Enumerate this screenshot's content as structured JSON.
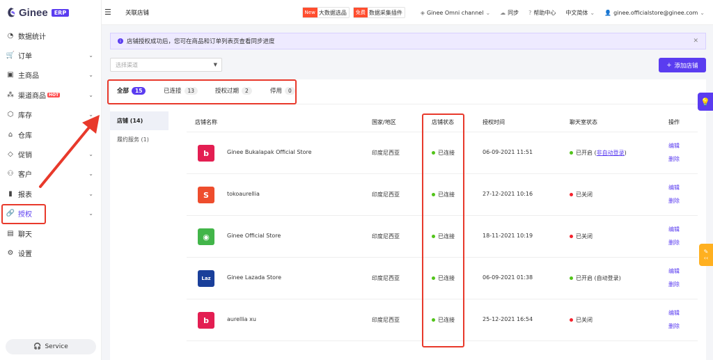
{
  "brand": {
    "name": "Ginee",
    "badge": "ERP"
  },
  "sidebar": {
    "items": [
      {
        "label": "数据统计",
        "icon": "dashboard-icon",
        "chev": false
      },
      {
        "label": "订单",
        "icon": "cart-icon",
        "chev": true
      },
      {
        "label": "主商品",
        "icon": "bag-icon",
        "chev": true
      },
      {
        "label": "渠道商品",
        "icon": "channel-icon",
        "chev": true,
        "hot": "HOT"
      },
      {
        "label": "库存",
        "icon": "box-icon",
        "chev": true
      },
      {
        "label": "仓库",
        "icon": "warehouse-icon",
        "chev": false
      },
      {
        "label": "促销",
        "icon": "tag-icon",
        "chev": true
      },
      {
        "label": "客户",
        "icon": "users-icon",
        "chev": true
      },
      {
        "label": "报表",
        "icon": "chart-icon",
        "chev": true
      },
      {
        "label": "授权",
        "icon": "link-icon",
        "chev": true,
        "active": true
      },
      {
        "label": "聊天",
        "icon": "chat-icon",
        "chev": false
      },
      {
        "label": "设置",
        "icon": "gear-icon",
        "chev": false
      }
    ],
    "service_label": "Service"
  },
  "header": {
    "title": "关联店铺",
    "big_data_tag": "New",
    "big_data_label": "大数据选品",
    "plugin_tag": "免费",
    "plugin_label": "数据采集插件",
    "omni": "Ginee Omni channel",
    "sync": "同步",
    "help": "帮助中心",
    "language": "中文简体",
    "account": "ginee.officialstore@ginee.com"
  },
  "notice": {
    "text": "店铺授权成功后，您可在商品和订单列表页查看同步进度"
  },
  "toolbar": {
    "channel_placeholder": "选择渠道",
    "add_store": "添加店铺"
  },
  "tabs": [
    {
      "label": "全部",
      "count": "15",
      "active": true
    },
    {
      "label": "已连接",
      "count": "13"
    },
    {
      "label": "授权过期",
      "count": "2"
    },
    {
      "label": "停用",
      "count": "0"
    }
  ],
  "subnav": [
    {
      "label": "店铺 (14)",
      "active": true
    },
    {
      "label": "履约服务 (1)"
    }
  ],
  "table": {
    "columns": [
      "店铺名称",
      "国家/地区",
      "店铺状态",
      "授权时间",
      "聊天室状态",
      "操作"
    ],
    "rows": [
      {
        "logo": "bukalapak",
        "name": "Ginee Bukalapak Official Store",
        "country": "印度尼西亚",
        "status": "已连接",
        "time": "06-09-2021 11:51",
        "chat": "已开启 (",
        "chat_link": "非自动登录",
        "chat_suffix": ")",
        "chat_on": true,
        "edit": "编辑",
        "delete": "删除"
      },
      {
        "logo": "shopee",
        "name": "tokoaurellia",
        "country": "印度尼西亚",
        "status": "已连接",
        "time": "27-12-2021 10:16",
        "chat": "已关闭",
        "chat_link": "",
        "chat_suffix": "",
        "chat_on": false,
        "edit": "编辑",
        "delete": "删除"
      },
      {
        "logo": "tokopedia",
        "name": "Ginee Official Store",
        "country": "印度尼西亚",
        "status": "已连接",
        "time": "18-11-2021 10:19",
        "chat": "已关闭",
        "chat_link": "",
        "chat_suffix": "",
        "chat_on": false,
        "edit": "编辑",
        "delete": "删除"
      },
      {
        "logo": "lazada",
        "name": "Ginee Lazada Store",
        "country": "印度尼西亚",
        "status": "已连接",
        "time": "06-09-2021 01:38",
        "chat": "已开启 (自动登录)",
        "chat_link": "",
        "chat_suffix": "",
        "chat_on": true,
        "edit": "编辑",
        "delete": "删除"
      },
      {
        "logo": "bukalapak",
        "name": "aurellia xu",
        "country": "印度尼西亚",
        "status": "已连接",
        "time": "25-12-2021 16:54",
        "chat": "已关闭",
        "chat_link": "",
        "chat_suffix": "",
        "chat_on": false,
        "edit": "编辑",
        "delete": "删除"
      }
    ]
  },
  "colors": {
    "accent": "#5a3cf0",
    "connected": "#52c41a",
    "closed": "#f5222d",
    "highlight": "#e8392b"
  }
}
